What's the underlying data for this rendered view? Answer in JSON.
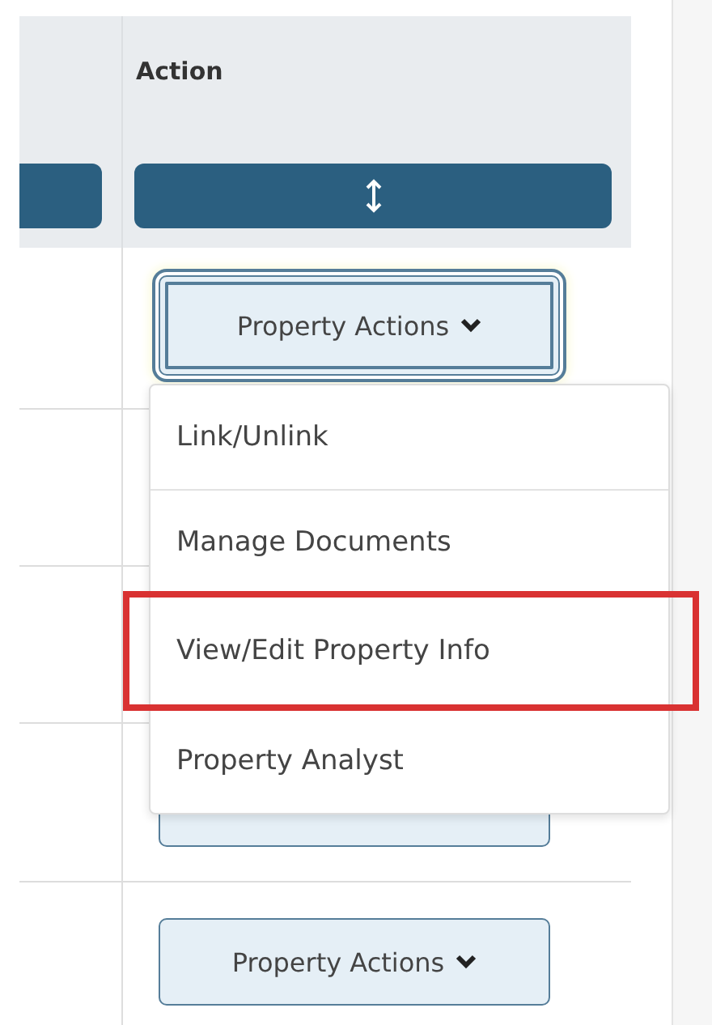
{
  "table": {
    "header": {
      "action_column": "Action"
    },
    "filters": [
      {
        "kind": "bar"
      },
      {
        "kind": "sort"
      }
    ],
    "rows": [
      {
        "kind": "menu-button",
        "label": "Property Actions",
        "focused": true
      },
      {
        "kind": "none"
      },
      {
        "kind": "none"
      },
      {
        "kind": "covered-button"
      },
      {
        "kind": "menu-button",
        "label": "Property Actions",
        "focused": false
      }
    ]
  },
  "menu": {
    "items": [
      {
        "label": "Link/Unlink",
        "highlighted": false
      },
      {
        "label": "Manage Documents",
        "highlighted": false
      },
      {
        "label": "View/Edit Property Info",
        "highlighted": true
      },
      {
        "label": "Property Analyst",
        "highlighted": false
      }
    ]
  }
}
